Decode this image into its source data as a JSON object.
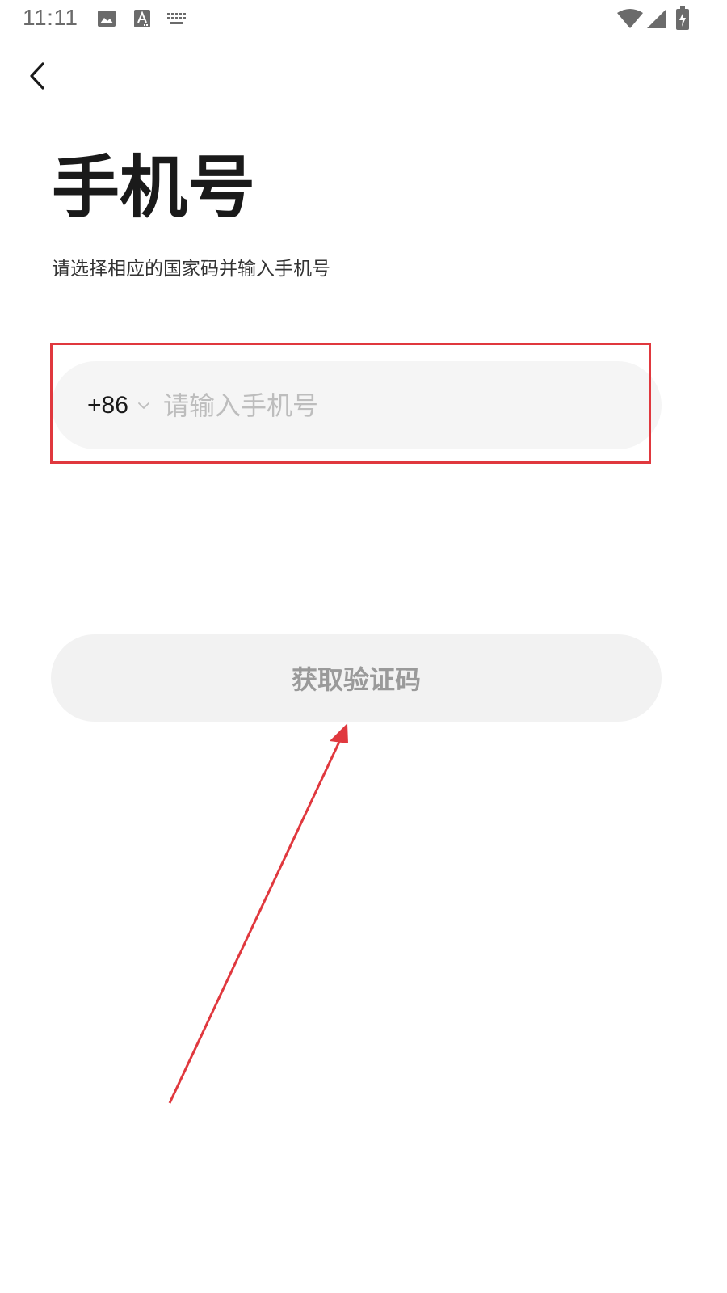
{
  "status_bar": {
    "time": "11:11",
    "icons": [
      "image-icon",
      "a-text-icon",
      "keyboard-icon",
      "wifi-icon",
      "signal-icon",
      "battery-icon"
    ]
  },
  "header": {
    "back_icon": "chevron-left-icon"
  },
  "page": {
    "title": "手机号",
    "subtitle": "请选择相应的国家码并输入手机号"
  },
  "phone_input": {
    "country_code": "+86",
    "placeholder": "请输入手机号",
    "value": ""
  },
  "actions": {
    "get_code_label": "获取验证码"
  },
  "colors": {
    "annotation_red": "#e0383e",
    "input_bg": "#f5f5f5",
    "button_bg": "#f2f2f2",
    "button_text": "#9a9a9a",
    "placeholder": "#bdbdbd"
  }
}
